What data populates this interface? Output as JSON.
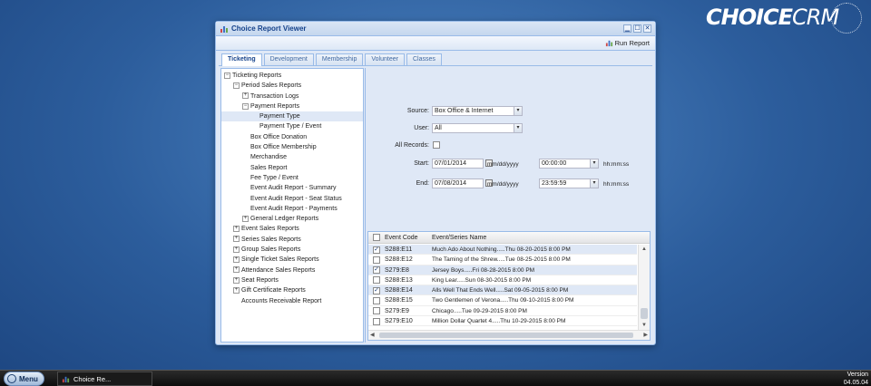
{
  "brand": {
    "logo_choice": "CHOICE",
    "logo_crm": "CRM"
  },
  "window": {
    "title": "Choice Report Viewer",
    "controls": {
      "minimize": "▁",
      "maximize": "☐",
      "close": "✕"
    },
    "toolbar": {
      "run_report": "Run Report"
    },
    "tabs": [
      {
        "label": "Ticketing",
        "active": true
      },
      {
        "label": "Development",
        "active": false
      },
      {
        "label": "Membership",
        "active": false
      },
      {
        "label": "Volunteer",
        "active": false
      },
      {
        "label": "Classes",
        "active": false
      }
    ]
  },
  "tree": [
    {
      "label": "Ticketing Reports",
      "level": 0,
      "toggle": "−"
    },
    {
      "label": "Period Sales Reports",
      "level": 1,
      "toggle": "−"
    },
    {
      "label": "Transaction Logs",
      "level": 2,
      "toggle": "+"
    },
    {
      "label": "Payment Reports",
      "level": 2,
      "toggle": "−"
    },
    {
      "label": "Payment Type",
      "level": 3,
      "toggle": "",
      "selected": true
    },
    {
      "label": "Payment Type / Event",
      "level": 3,
      "toggle": ""
    },
    {
      "label": "Box Office Donation",
      "level": 2,
      "toggle": ""
    },
    {
      "label": "Box Office Membership",
      "level": 2,
      "toggle": ""
    },
    {
      "label": "Merchandise",
      "level": 2,
      "toggle": ""
    },
    {
      "label": "Sales Report",
      "level": 2,
      "toggle": ""
    },
    {
      "label": "Fee Type / Event",
      "level": 2,
      "toggle": ""
    },
    {
      "label": "Event Audit Report - Summary",
      "level": 2,
      "toggle": ""
    },
    {
      "label": "Event Audit Report - Seat Status",
      "level": 2,
      "toggle": ""
    },
    {
      "label": "Event Audit Report - Payments",
      "level": 2,
      "toggle": ""
    },
    {
      "label": "General Ledger Reports",
      "level": 2,
      "toggle": "+"
    },
    {
      "label": "Event Sales Reports",
      "level": 1,
      "toggle": "+"
    },
    {
      "label": "Series Sales Reports",
      "level": 1,
      "toggle": "+"
    },
    {
      "label": "Group Sales Reports",
      "level": 1,
      "toggle": "+"
    },
    {
      "label": "Single Ticket Sales Reports",
      "level": 1,
      "toggle": "+"
    },
    {
      "label": "Attendance Sales Reports",
      "level": 1,
      "toggle": "+"
    },
    {
      "label": "Seat Reports",
      "level": 1,
      "toggle": "+"
    },
    {
      "label": "Gift Certificate Reports",
      "level": 1,
      "toggle": "+"
    },
    {
      "label": "Accounts Receivable Report",
      "level": 1,
      "toggle": ""
    }
  ],
  "form": {
    "source_label": "Source:",
    "source_value": "Box Office & Internet",
    "user_label": "User:",
    "user_value": "All",
    "all_records_label": "All Records:",
    "start_label": "Start:",
    "start_date": "07/01/2014",
    "start_time": "00:00:00",
    "end_label": "End:",
    "end_date": "07/08/2014",
    "end_time": "23:59:59",
    "date_hint": "mm/dd/yyyy",
    "time_hint": "hh:mm:ss"
  },
  "grid": {
    "headers": {
      "code": "Event Code",
      "name": "Event/Series Name"
    },
    "rows": [
      {
        "code": "S288:E11",
        "name": "Much Ado About Nothing.....Thu 08-20-2015 8:00 PM",
        "checked": true
      },
      {
        "code": "S288:E12",
        "name": "The Taming of the Shrew.....Tue 08-25-2015 8:00 PM",
        "checked": false
      },
      {
        "code": "S279:E8",
        "name": "Jersey Boys.....Fri 08-28-2015 8:00 PM",
        "checked": true
      },
      {
        "code": "S288:E13",
        "name": "King Lear.....Sun 08-30-2015 8:00 PM",
        "checked": false
      },
      {
        "code": "S288:E14",
        "name": "Alls Well That Ends Well.....Sat 09-05-2015 8:00 PM",
        "checked": true
      },
      {
        "code": "S288:E15",
        "name": "Two Gentlemen of Verona.....Thu 09-10-2015 8:00 PM",
        "checked": false
      },
      {
        "code": "S279:E9",
        "name": "Chicago.....Tue 09-29-2015 8:00 PM",
        "checked": false
      },
      {
        "code": "S279:E10",
        "name": "Million Dollar Quartet 4.....Thu 10-29-2015 8:00 PM",
        "checked": false
      }
    ]
  },
  "taskbar": {
    "menu_label": "Menu",
    "task_label": "Choice Re...",
    "version_label": "Version",
    "version_value": "04.05.04"
  }
}
